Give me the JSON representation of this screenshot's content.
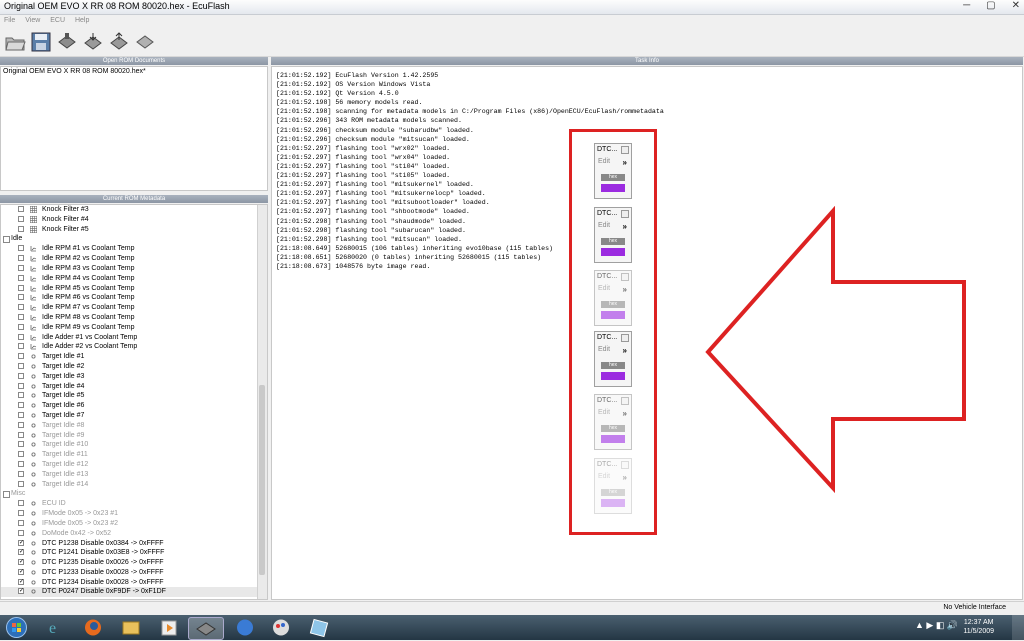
{
  "window": {
    "title": "Original OEM EVO X RR 08 ROM 80020.hex - EcuFlash",
    "controls": [
      "─",
      "▢",
      "✕"
    ]
  },
  "menu": [
    "File",
    "View",
    "ECU",
    "Help"
  ],
  "panels": {
    "open_rom_header": "Open ROM Documents",
    "open_rom_item": "Original OEM EVO X RR 08 ROM 80020.hex*",
    "metadata_header": "Current ROM Metadata",
    "task_header": "Task Info"
  },
  "tree": {
    "knock": [
      "Knock Filter #3",
      "Knock Filter #4",
      "Knock Filter #5"
    ],
    "idle_group": "Idle",
    "idle_items": [
      "Idle RPM #1 vs Coolant Temp",
      "Idle RPM #2 vs Coolant Temp",
      "Idle RPM #3 vs Coolant Temp",
      "Idle RPM #4 vs Coolant Temp",
      "Idle RPM #5 vs Coolant Temp",
      "Idle RPM #6 vs Coolant Temp",
      "Idle RPM #7 vs Coolant Temp",
      "Idle RPM #8 vs Coolant Temp",
      "Idle RPM #9 vs Coolant Temp",
      "Idle Adder #1 vs Coolant Temp",
      "Idle Adder #2 vs Coolant Temp",
      "Target Idle #1",
      "Target Idle #2",
      "Target Idle #3",
      "Target Idle #4",
      "Target Idle #5",
      "Target Idle #6",
      "Target Idle #7",
      "Target Idle #8",
      "Target Idle #9",
      "Target Idle #10",
      "Target Idle #11",
      "Target Idle #12",
      "Target Idle #13",
      "Target Idle #14"
    ],
    "misc_group": "Misc",
    "misc_items": [
      "ECU ID",
      "IFMode 0x05 -> 0x23 #1",
      "IFMode 0x05 -> 0x23 #2",
      "DoMode 0x42 -> 0x52",
      "DTC P1238 Disable 0x0384 -> 0xFFFF",
      "DTC P1241 Disable 0x03E8 -> 0xFFFF",
      "DTC P1235 Disable 0x0026 -> 0xFFFF",
      "DTC P1233 Disable 0x0028 -> 0xFFFF",
      "DTC P1234 Disable 0x0028 -> 0xFFFF",
      "DTC P0247 Disable 0xF9DF -> 0xF1DF"
    ]
  },
  "log": [
    "[21:01:52.192] EcuFlash Version 1.42.2595",
    "[21:01:52.192] OS Version Windows Vista",
    "[21:01:52.192] Qt Version 4.5.0",
    "[21:01:52.198] 56 memory models read.",
    "[21:01:52.198] scanning for metadata models in C:/Program Files (x86)/OpenECU/EcuFlash/rommetadata",
    "[21:01:52.296] 343 ROM metadata models scanned.",
    "[21:01:52.296] checksum module \"subarudbw\" loaded.",
    "[21:01:52.296] checksum module \"mitsucan\" loaded.",
    "[21:01:52.297] flashing tool \"wrx02\" loaded.",
    "[21:01:52.297] flashing tool \"wrx04\" loaded.",
    "[21:01:52.297] flashing tool \"sti04\" loaded.",
    "[21:01:52.297] flashing tool \"sti05\" loaded.",
    "[21:01:52.297] flashing tool \"mitsukernel\" loaded.",
    "[21:01:52.297] flashing tool \"mitsukernelocp\" loaded.",
    "[21:01:52.297] flashing tool \"mitsubootloader\" loaded.",
    "[21:01:52.297] flashing tool \"shbootmode\" loaded.",
    "[21:01:52.298] flashing tool \"shaudmode\" loaded.",
    "[21:01:52.298] flashing tool \"subarucan\" loaded.",
    "[21:01:52.298] flashing tool \"mitsucan\" loaded.",
    "[21:18:08.649] 52680015 (106 tables) inheriting evo10base (115 tables)",
    "[21:18:08.651] 52680020 (0 tables) inheriting 52680015 (115 tables)",
    "[21:18:08.673] 1048576 byte image read."
  ],
  "dtc_widget": {
    "title": "DTC...",
    "edit": "Edit",
    "hex": "hex",
    "arrow": "»"
  },
  "status": "No Vehicle Interface",
  "clock": {
    "time": "12:37 AM",
    "date": "11/5/2009"
  },
  "colors": {
    "accent_purple": "#9b2be0",
    "annotation_red": "#dd2222"
  }
}
